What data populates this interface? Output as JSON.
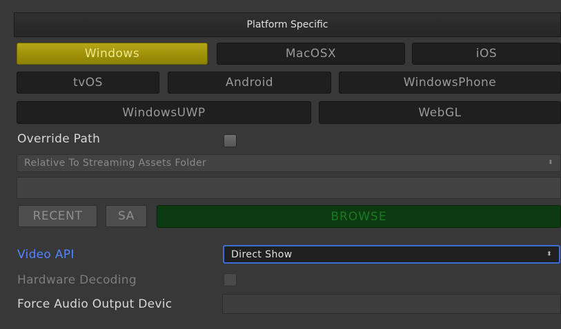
{
  "header": {
    "title": "Platform Specific"
  },
  "platforms": {
    "row1": [
      "Windows",
      "MacOSX",
      "iOS"
    ],
    "row2": [
      "tvOS",
      "Android",
      "WindowsPhone"
    ],
    "row3": [
      "WindowsUWP",
      "WebGL"
    ],
    "selected": "Windows"
  },
  "override_path": {
    "label": "Override Path",
    "checked": false
  },
  "path_mode": {
    "value": "Relative To Streaming Assets Folder",
    "arrow": "⬍"
  },
  "path_field": {
    "value": ""
  },
  "buttons": {
    "recent": "RECENT",
    "sa": "SA",
    "browse": "BROWSE"
  },
  "video_api": {
    "label": "Video API",
    "value": "Direct Show",
    "arrow": "⬍"
  },
  "hardware_decoding": {
    "label": "Hardware Decoding",
    "checked": false
  },
  "force_audio": {
    "label": "Force Audio Output Devic",
    "value": ""
  },
  "colors": {
    "accent": "#3d6fd8",
    "selected": "#a89a0c",
    "browse": "#0d3a10"
  }
}
